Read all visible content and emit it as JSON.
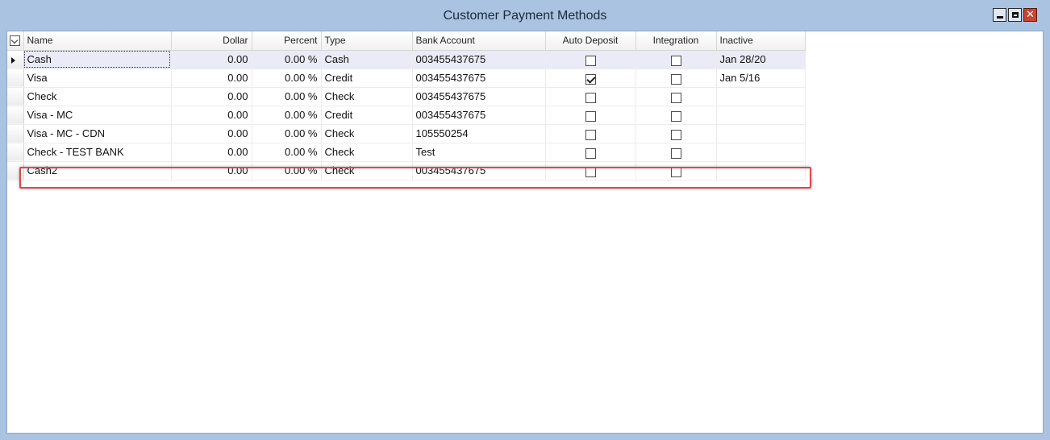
{
  "window": {
    "title": "Customer Payment Methods",
    "controls": {
      "minimize": "minimize-icon",
      "maximize": "maximize-icon",
      "close": "close-icon"
    }
  },
  "grid": {
    "columns": {
      "name": "Name",
      "dollar": "Dollar",
      "percent": "Percent",
      "type": "Type",
      "bank_account": "Bank Account",
      "auto_deposit": "Auto Deposit",
      "integration": "Integration",
      "inactive": "Inactive"
    },
    "rows": [
      {
        "name": "Cash",
        "dollar": "0.00",
        "percent": "0.00 %",
        "type": "Cash",
        "bank_account": "003455437675",
        "auto_deposit": false,
        "integration": false,
        "inactive": "Jan 28/20"
      },
      {
        "name": "Visa",
        "dollar": "0.00",
        "percent": "0.00 %",
        "type": "Credit",
        "bank_account": "003455437675",
        "auto_deposit": true,
        "integration": false,
        "inactive": "Jan 5/16"
      },
      {
        "name": "Check",
        "dollar": "0.00",
        "percent": "0.00 %",
        "type": "Check",
        "bank_account": "003455437675",
        "auto_deposit": false,
        "integration": false,
        "inactive": ""
      },
      {
        "name": "Visa - MC",
        "dollar": "0.00",
        "percent": "0.00 %",
        "type": "Credit",
        "bank_account": "003455437675",
        "auto_deposit": false,
        "integration": false,
        "inactive": ""
      },
      {
        "name": "Visa - MC - CDN",
        "dollar": "0.00",
        "percent": "0.00 %",
        "type": "Check",
        "bank_account": "105550254",
        "auto_deposit": false,
        "integration": false,
        "inactive": ""
      },
      {
        "name": "Check - TEST BANK",
        "dollar": "0.00",
        "percent": "0.00 %",
        "type": "Check",
        "bank_account": "Test",
        "auto_deposit": false,
        "integration": false,
        "inactive": ""
      },
      {
        "name": "Cash2",
        "dollar": "0.00",
        "percent": "0.00 %",
        "type": "Check",
        "bank_account": "003455437675",
        "auto_deposit": false,
        "integration": false,
        "inactive": ""
      }
    ]
  },
  "colors": {
    "title_bar": "#a9c3e0",
    "current_row": "#ebebf8",
    "highlight_box": "#e0474c"
  }
}
